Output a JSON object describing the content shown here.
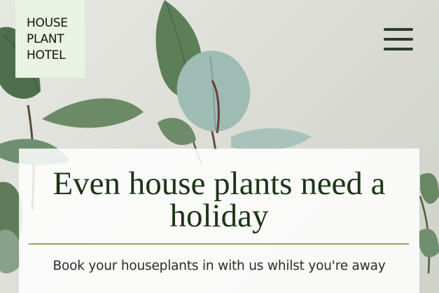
{
  "logo": {
    "line1": "HOUSE",
    "line2": "PLANT",
    "line3": "HOTEL"
  },
  "hero": {
    "headline": "Even house plants need a holiday",
    "subtitle": "Book your houseplants in with us whilst you're away"
  },
  "colors": {
    "logo_bg": "#e9f3e4",
    "headline": "#1b3515",
    "divider": "#8aa865",
    "menu_icon": "#2e3d2b"
  },
  "icons": {
    "menu": "hamburger-menu-icon"
  }
}
